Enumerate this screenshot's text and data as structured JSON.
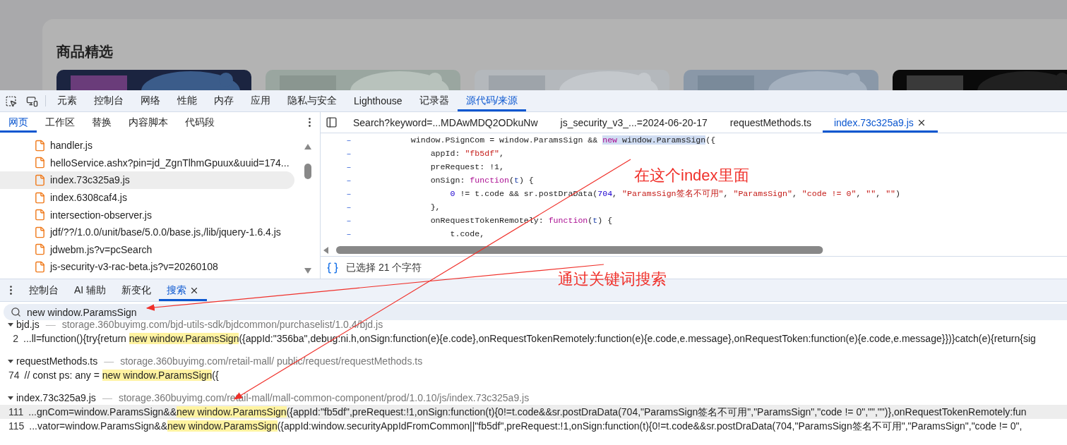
{
  "page": {
    "section_title": "商品精选"
  },
  "devtools": {
    "panel_tabs": [
      {
        "label": "元素",
        "selected": false
      },
      {
        "label": "控制台",
        "selected": false
      },
      {
        "label": "网络",
        "selected": false
      },
      {
        "label": "性能",
        "selected": false
      },
      {
        "label": "内存",
        "selected": false
      },
      {
        "label": "应用",
        "selected": false
      },
      {
        "label": "隐私与安全",
        "selected": false
      },
      {
        "label": "Lighthouse",
        "selected": false
      },
      {
        "label": "记录器",
        "selected": false
      },
      {
        "label": "源代码/来源",
        "selected": true
      }
    ],
    "navigator_tabs": [
      {
        "label": "网页",
        "selected": true
      },
      {
        "label": "工作区",
        "selected": false
      },
      {
        "label": "替换",
        "selected": false
      },
      {
        "label": "内容脚本",
        "selected": false
      },
      {
        "label": "代码段",
        "selected": false
      }
    ],
    "files": [
      {
        "name": "handler.js",
        "selected": false
      },
      {
        "name": "helloService.ashx?pin=jd_ZgnTlhmGpuux&uuid=174...",
        "selected": false
      },
      {
        "name": "index.73c325a9.js",
        "selected": true
      },
      {
        "name": "index.6308caf4.js",
        "selected": false
      },
      {
        "name": "intersection-observer.js",
        "selected": false
      },
      {
        "name": "jdf/??/1.0.0/unit/base/5.0.0/base.js,/lib/jquery-1.6.4.js",
        "selected": false
      },
      {
        "name": "jdwebm.js?v=pcSearch",
        "selected": false
      },
      {
        "name": "js-security-v3-rac-beta.js?v=20260108",
        "selected": false
      }
    ],
    "editor_tabs": [
      {
        "label": "Search?keyword=...MDAwMDQ2ODkuNw",
        "selected": false,
        "closable": false
      },
      {
        "label": "js_security_v3_...=2024-06-20-17",
        "selected": false,
        "closable": false
      },
      {
        "label": "requestMethods.ts",
        "selected": false,
        "closable": false
      },
      {
        "label": "index.73c325a9.js",
        "selected": true,
        "closable": true
      }
    ],
    "code_lines": [
      {
        "marker": "–",
        "tokens": [
          {
            "text": "    window.PSignCom = window.ParamsSign && ",
            "kind": "plain",
            "selected": false
          },
          {
            "text": "new",
            "kind": "keyword",
            "selected": true
          },
          {
            "text": " window.ParamsSign",
            "kind": "plain",
            "selected": true
          },
          {
            "text": "({",
            "kind": "plain",
            "selected": false
          }
        ]
      },
      {
        "marker": "–",
        "tokens": [
          {
            "text": "        appId: ",
            "kind": "plain"
          },
          {
            "text": "\"fb5df\"",
            "kind": "string"
          },
          {
            "text": ",",
            "kind": "plain"
          }
        ]
      },
      {
        "marker": "–",
        "tokens": [
          {
            "text": "        preRequest: !1,",
            "kind": "plain"
          }
        ]
      },
      {
        "marker": "–",
        "tokens": [
          {
            "text": "        onSign: ",
            "kind": "plain"
          },
          {
            "text": "function",
            "kind": "keyword"
          },
          {
            "text": "(",
            "kind": "plain"
          },
          {
            "text": "t",
            "kind": "param"
          },
          {
            "text": ") {",
            "kind": "plain"
          }
        ]
      },
      {
        "marker": "–",
        "tokens": [
          {
            "text": "            0",
            "kind": "number"
          },
          {
            "text": " != t.code && sr.postDraData(",
            "kind": "plain"
          },
          {
            "text": "704",
            "kind": "number"
          },
          {
            "text": ", ",
            "kind": "plain"
          },
          {
            "text": "\"ParamsSign签名不可用\"",
            "kind": "string"
          },
          {
            "text": ", ",
            "kind": "plain"
          },
          {
            "text": "\"ParamsSign\"",
            "kind": "string"
          },
          {
            "text": ", ",
            "kind": "plain"
          },
          {
            "text": "\"code != 0\"",
            "kind": "string"
          },
          {
            "text": ", ",
            "kind": "plain"
          },
          {
            "text": "\"\"",
            "kind": "string"
          },
          {
            "text": ", ",
            "kind": "plain"
          },
          {
            "text": "\"\"",
            "kind": "string"
          },
          {
            "text": ")",
            "kind": "plain"
          }
        ]
      },
      {
        "marker": "–",
        "tokens": [
          {
            "text": "        },",
            "kind": "plain"
          }
        ]
      },
      {
        "marker": "–",
        "tokens": [
          {
            "text": "        onRequestTokenRemotely: ",
            "kind": "plain"
          },
          {
            "text": "function",
            "kind": "keyword"
          },
          {
            "text": "(",
            "kind": "plain"
          },
          {
            "text": "t",
            "kind": "param"
          },
          {
            "text": ") {",
            "kind": "plain"
          }
        ]
      },
      {
        "marker": "–",
        "tokens": [
          {
            "text": "            t.code,",
            "kind": "plain"
          }
        ]
      }
    ],
    "status": "已选择 21 个字符",
    "drawer_tabs": [
      {
        "label": "控制台",
        "selected": false,
        "closable": false
      },
      {
        "label": "AI 辅助",
        "selected": false,
        "closable": false
      },
      {
        "label": "新变化",
        "selected": false,
        "closable": false
      },
      {
        "label": "搜索",
        "selected": true,
        "closable": true
      }
    ],
    "search": {
      "value": "new window.ParamsSign"
    },
    "results": [
      {
        "file": "bjd.js",
        "separator": "—",
        "path": "storage.360buyimg.com/bjd-utils-sdk/bjdcommon/purchaselist/1.0.4/bjd.js",
        "expanded": true,
        "matches": [
          {
            "line": "2",
            "before": "...ll=function(){try{return ",
            "match": "new window.ParamsSign",
            "after": "({appId:\"356ba\",debug:ni.h,onSign:function(e){e.code},onRequestTokenRemotely:function(e){e.code,e.message},onRequestToken:function(e){e.code,e.message}})}catch(e){return{sig",
            "selected": false
          }
        ]
      },
      {
        "file": "requestMethods.ts",
        "separator": "—",
        "path": "storage.360buyimg.com/retail-mall/ public/request/requestMethods.ts",
        "expanded": true,
        "matches": [
          {
            "line": "74",
            "before": "// const ps: any = ",
            "match": "new window.ParamsSign",
            "after": "({",
            "selected": false
          }
        ]
      },
      {
        "file": "index.73c325a9.js",
        "separator": "—",
        "path": "storage.360buyimg.com/retail-mall/mall-common-component/prod/1.0.10/js/index.73c325a9.js",
        "expanded": true,
        "matches": [
          {
            "line": "111",
            "before": "...gnCom=window.ParamsSign&&",
            "match": "new window.ParamsSign",
            "after": "({appId:\"fb5df\",preRequest:!1,onSign:function(t){0!=t.code&&sr.postDraData(704,\"ParamsSign签名不可用\",\"ParamsSign\",\"code != 0\",\"\",\"\")},onRequestTokenRemotely:fun",
            "selected": true
          },
          {
            "line": "115",
            "before": "...vator=window.ParamsSign&&",
            "match": "new window.ParamsSign",
            "after": "({appId:window.securityAppIdFromCommon||\"fb5df\",preRequest:!1,onSign:function(t){0!=t.code&&sr.postDraData(704,\"ParamsSign签名不可用\",\"ParamsSign\",\"code != 0\",",
            "selected": false
          }
        ]
      }
    ]
  },
  "annotations": [
    {
      "text": "在这个index里面"
    },
    {
      "text": "通过关键词搜索"
    }
  ]
}
